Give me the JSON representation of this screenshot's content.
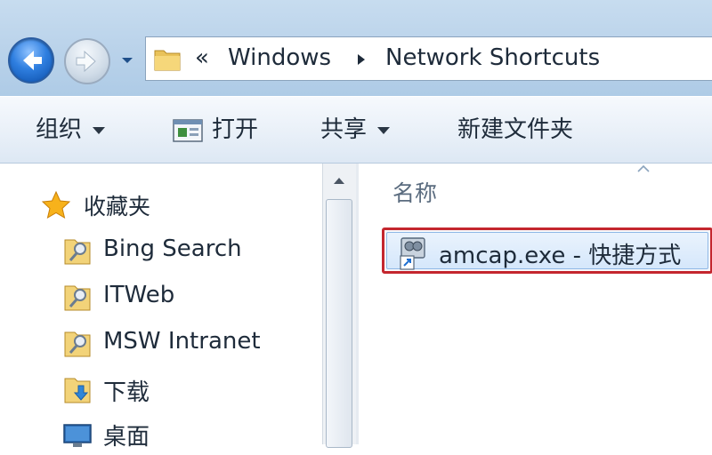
{
  "address": {
    "overflow_chevron": "«",
    "breadcrumb": [
      "Windows",
      "Network Shortcuts"
    ]
  },
  "toolbar": {
    "organize_label": "组织",
    "open_label": "打开",
    "share_label": "共享",
    "new_folder_label": "新建文件夹"
  },
  "navigation": {
    "favorites_label": "收藏夹",
    "items": [
      {
        "label": "Bing Search",
        "icon": "network-shortcut-icon"
      },
      {
        "label": "ITWeb",
        "icon": "network-shortcut-icon"
      },
      {
        "label": "MSW Intranet",
        "icon": "network-shortcut-icon"
      },
      {
        "label": "下载",
        "icon": "downloads-folder-icon"
      },
      {
        "label": "桌面",
        "icon": "desktop-icon"
      }
    ]
  },
  "content": {
    "column_name": "名称",
    "files": [
      {
        "name": "amcap.exe - 快捷方式",
        "icon": "shortcut-icon",
        "selected": true
      }
    ]
  },
  "colors": {
    "highlight_border": "#c4262e",
    "selection_fill": "#d5e7fb",
    "toolbar_bg": "#e9f0f8",
    "address_band": "#b9d2ea"
  }
}
